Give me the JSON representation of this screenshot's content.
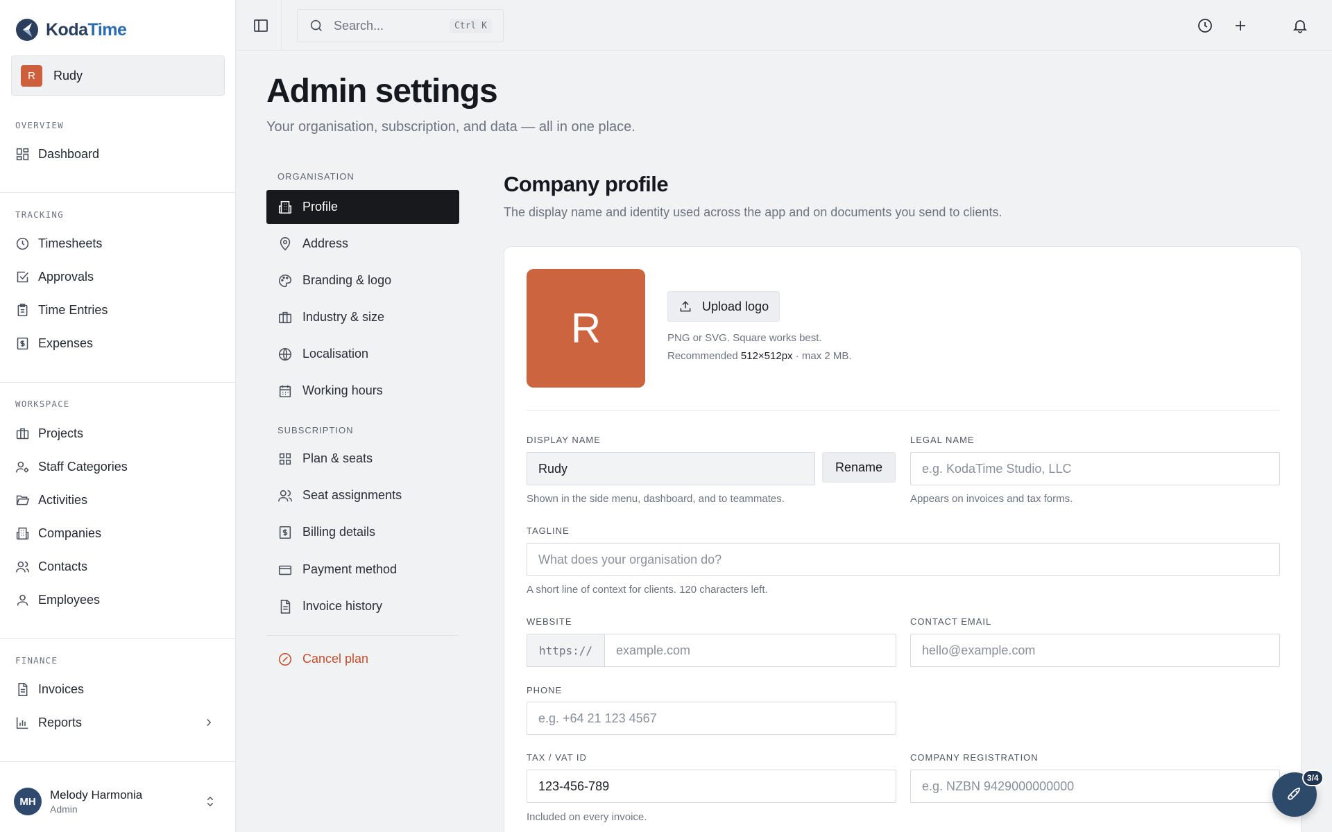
{
  "app": {
    "brand_prefix": "Koda",
    "brand_suffix": "Time",
    "org_initial": "R",
    "org_name": "Rudy"
  },
  "sidebar": {
    "sections": [
      {
        "label": "OVERVIEW",
        "items": [
          {
            "label": "Dashboard",
            "icon": "dashboard-icon"
          }
        ]
      },
      {
        "label": "TRACKING",
        "items": [
          {
            "label": "Timesheets",
            "icon": "clock-icon"
          },
          {
            "label": "Approvals",
            "icon": "check-square-icon"
          },
          {
            "label": "Time Entries",
            "icon": "clipboard-icon"
          },
          {
            "label": "Expenses",
            "icon": "receipt-dollar-icon"
          }
        ]
      },
      {
        "label": "WORKSPACE",
        "items": [
          {
            "label": "Projects",
            "icon": "briefcase-icon"
          },
          {
            "label": "Staff Categories",
            "icon": "user-cog-icon"
          },
          {
            "label": "Activities",
            "icon": "folder-open-icon"
          },
          {
            "label": "Companies",
            "icon": "building-icon"
          },
          {
            "label": "Contacts",
            "icon": "users-icon"
          },
          {
            "label": "Employees",
            "icon": "user-icon"
          }
        ]
      },
      {
        "label": "FINANCE",
        "items": [
          {
            "label": "Invoices",
            "icon": "file-text-icon"
          },
          {
            "label": "Reports",
            "icon": "bar-chart-icon"
          }
        ]
      }
    ],
    "user": {
      "initials": "MH",
      "name": "Melody Harmonia",
      "role": "Admin"
    }
  },
  "topbar": {
    "search_placeholder": "Search...",
    "search_shortcut": "Ctrl K"
  },
  "page": {
    "title": "Admin settings",
    "subtitle": "Your organisation, subscription, and data — all in one place."
  },
  "settings_nav": {
    "organisation_label": "ORGANISATION",
    "organisation_items": [
      {
        "label": "Profile",
        "icon": "building-icon",
        "active": true
      },
      {
        "label": "Address",
        "icon": "map-pin-icon"
      },
      {
        "label": "Branding & logo",
        "icon": "palette-icon"
      },
      {
        "label": "Industry & size",
        "icon": "briefcase-icon"
      },
      {
        "label": "Localisation",
        "icon": "globe-icon"
      },
      {
        "label": "Working hours",
        "icon": "calendar-icon"
      }
    ],
    "subscription_label": "SUBSCRIPTION",
    "subscription_items": [
      {
        "label": "Plan & seats",
        "icon": "grid-icon"
      },
      {
        "label": "Seat assignments",
        "icon": "users-icon"
      },
      {
        "label": "Billing details",
        "icon": "receipt-dollar-icon"
      },
      {
        "label": "Payment method",
        "icon": "credit-card-icon"
      },
      {
        "label": "Invoice history",
        "icon": "file-text-icon"
      }
    ],
    "cancel_label": "Cancel plan"
  },
  "profile": {
    "title": "Company profile",
    "description": "The display name and identity used across the app and on documents you send to clients.",
    "logo_initial": "R",
    "upload_label": "Upload logo",
    "upload_hint_1": "PNG or SVG. Square works best.",
    "upload_hint_2_prefix": "Recommended ",
    "upload_hint_2_size": "512×512px",
    "upload_hint_2_suffix": " · max 2 MB.",
    "display_name": {
      "label": "DISPLAY NAME",
      "value": "Rudy",
      "button": "Rename",
      "help": "Shown in the side menu, dashboard, and to teammates."
    },
    "legal_name": {
      "label": "LEGAL NAME",
      "placeholder": "e.g. KodaTime Studio, LLC",
      "help": "Appears on invoices and tax forms."
    },
    "tagline": {
      "label": "TAGLINE",
      "placeholder": "What does your organisation do?",
      "help": "A short line of context for clients. 120 characters left."
    },
    "website": {
      "label": "WEBSITE",
      "prefix": "https://",
      "placeholder": "example.com"
    },
    "contact_email": {
      "label": "CONTACT EMAIL",
      "placeholder": "hello@example.com"
    },
    "phone": {
      "label": "PHONE",
      "placeholder": "e.g. +64 21 123 4567"
    },
    "tax_id": {
      "label": "TAX / VAT ID",
      "value": "123-456-789",
      "help": "Included on every invoice."
    },
    "company_registration": {
      "label": "COMPANY REGISTRATION",
      "placeholder": "e.g. NZBN 9429000000000"
    }
  },
  "launcher": {
    "progress": "3/4"
  },
  "colors": {
    "accent": "#cd6440",
    "active_nav": "#17191d",
    "danger": "#c24e2c",
    "brand": "#2b6cb0"
  }
}
